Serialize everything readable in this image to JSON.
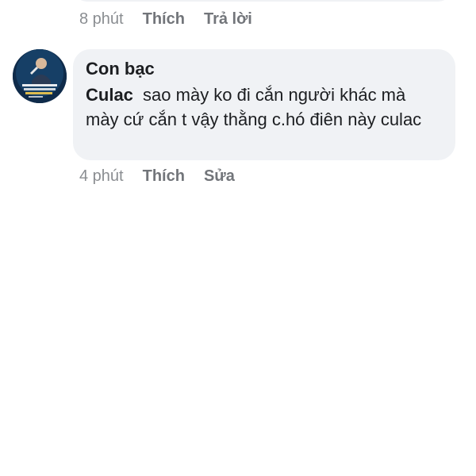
{
  "previous_comment": {
    "time": "8 phút",
    "like_label": "Thích",
    "reply_label": "Trả lời"
  },
  "comment": {
    "author": "Con bạc",
    "mention": "Culac",
    "text": "sao mày ko đi cắn người khác mà mày cứ cắn t vậy thằng c.hó điên này culac",
    "time": "4 phút",
    "like_label": "Thích",
    "edit_label": "Sửa"
  },
  "colors": {
    "bubble": "#f0f2f5",
    "meta_text": "#72757a",
    "text": "#1c1e21",
    "avatar_bg": "#0f2b4a"
  },
  "icons": {
    "avatar": "profile-photo"
  }
}
